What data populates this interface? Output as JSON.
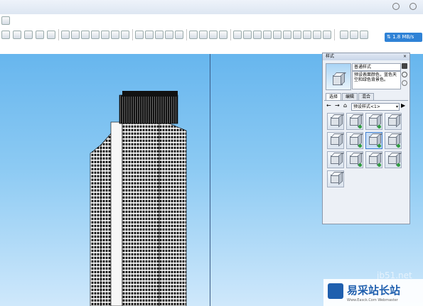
{
  "network": {
    "speed": "1.8 MB/s"
  },
  "styles_panel": {
    "title": "样式",
    "style_name": "普通样式",
    "style_desc": "预设表面颜色，蓝色天空和绿色背景色。",
    "tabs": [
      {
        "label": "选择"
      },
      {
        "label": "编辑"
      },
      {
        "label": "混合"
      }
    ],
    "library": {
      "selected": "预设样式<1>"
    }
  },
  "watermark": {
    "site": "jb51.net",
    "brand": "易采站长站",
    "sub": "Www.Easck.Com Webmaster"
  },
  "colors": {
    "sky_top": "#67b6ee",
    "sky_bottom": "#cfe8fb",
    "tab_active": "#ffffff",
    "accent": "#3f7fd0"
  }
}
